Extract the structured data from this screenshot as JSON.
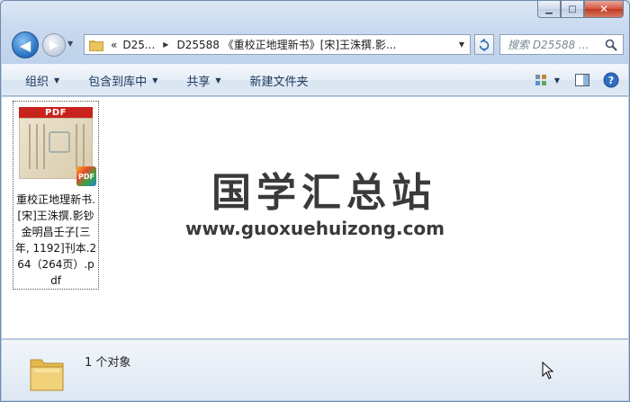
{
  "window": {
    "caption": {
      "minimize": "▁",
      "maximize": "□",
      "close": "✕"
    }
  },
  "nav": {
    "back_glyph": "◀",
    "forward_glyph": "▶",
    "address": {
      "overflow": "«",
      "segments": [
        "D25...",
        "D25588 《重校正地理新书》[宋]王洙撰.影..."
      ]
    },
    "search": {
      "placeholder": "搜索 D25588 ..."
    }
  },
  "toolbar": {
    "items": [
      {
        "label": "组织",
        "dropdown": true
      },
      {
        "label": "包含到库中",
        "dropdown": true
      },
      {
        "label": "共享",
        "dropdown": true
      },
      {
        "label": "新建文件夹",
        "dropdown": false
      }
    ],
    "right_icons": [
      "view-icon",
      "preview-pane-icon",
      "help-icon"
    ]
  },
  "files": [
    {
      "name": "重校正地理新书.[宋]王洙撰.影钞金明昌壬子[三年, 1192]刊本.264（264页）.pdf",
      "thumb_label": "PDF",
      "badge_label": "PDF"
    }
  ],
  "watermark": {
    "title": "国学汇总站",
    "url": "www.guoxuehuizong.com"
  },
  "details": {
    "count_text": "1 个对象"
  },
  "colors": {
    "accent": "#2f79c8",
    "pdf_red": "#c8221c",
    "toolbar_text": "#1e395b"
  }
}
